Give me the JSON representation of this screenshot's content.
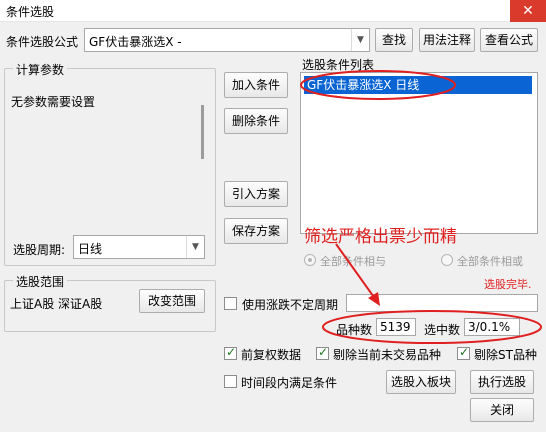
{
  "window": {
    "title": "条件选股",
    "close_glyph": "✕"
  },
  "formula": {
    "label": "条件选股公式",
    "selected": "GF伏击暴涨选X  -",
    "find_button": "查找",
    "usage_button": "用法注释",
    "view_button": "查看公式"
  },
  "params": {
    "group_title": "计算参数",
    "text": "无参数需要设置",
    "period_label": "选股周期:",
    "period_value": "日线"
  },
  "actions": {
    "add": "加入条件",
    "delete": "删除条件",
    "import": "引入方案",
    "save": "保存方案"
  },
  "conditions": {
    "title": "选股条件列表",
    "items": [
      "GF伏击暴涨选X  日线"
    ]
  },
  "logic": {
    "and_label": "全部条件相与",
    "or_label": "全部条件相或"
  },
  "annotation": {
    "text": "筛选严格出票少而精"
  },
  "status": {
    "done": "选股完毕."
  },
  "scope": {
    "group_title": "选股范围",
    "text": "上证A股 深证A股",
    "change_button": "改变范围"
  },
  "period_option": {
    "label": "使用涨跌不定周期",
    "value": ""
  },
  "stats": {
    "count_label": "品种数",
    "count_value": "5139",
    "selected_label": "选中数",
    "selected_value": "3/0.1%"
  },
  "options": {
    "fq": "前复权数据",
    "exclude_untraded": "剔除当前未交易品种",
    "exclude_st": "剔除ST品种",
    "time_range": "时间段内满足条件"
  },
  "bottom": {
    "to_board": "选股入板块",
    "execute": "执行选股",
    "close": "关闭"
  },
  "colors": {
    "annotation_red": "#e02020",
    "selection_blue": "#0a64d4"
  }
}
